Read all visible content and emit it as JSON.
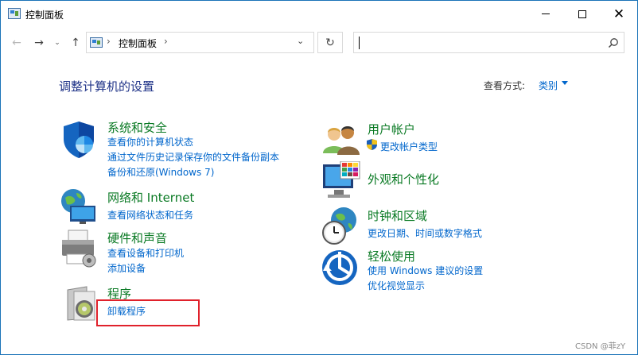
{
  "window": {
    "title": "控制面板",
    "controls": {
      "minimize": "—",
      "maximize": "□",
      "close": "✕"
    }
  },
  "nav": {
    "back": "←",
    "forward": "→",
    "history": "⌄",
    "up": "↑",
    "breadcrumb_sep": "›",
    "breadcrumb": "控制面板",
    "address_dropdown": "⌄",
    "refresh": "↻",
    "search_value": ""
  },
  "content": {
    "heading": "调整计算机的设置",
    "view_by_label": "查看方式:",
    "view_by_value": "类别"
  },
  "categories": [
    {
      "icon": "shield-icon",
      "title": "系统和安全",
      "links": [
        "查看你的计算机状态",
        "通过文件历史记录保存你的文件备份副本",
        "备份和还原(Windows 7)"
      ]
    },
    {
      "icon": "network-icon",
      "title": "网络和 Internet",
      "links": [
        "查看网络状态和任务"
      ]
    },
    {
      "icon": "printer-icon",
      "title": "硬件和声音",
      "links": [
        "查看设备和打印机",
        "添加设备"
      ]
    },
    {
      "icon": "programs-icon",
      "title": "程序",
      "links": [
        "卸载程序"
      ]
    },
    {
      "icon": "users-icon",
      "title": "用户帐户",
      "links": [
        "更改帐户类型"
      ]
    },
    {
      "icon": "monitor-icon",
      "title": "外观和个性化",
      "links": []
    },
    {
      "icon": "clock-globe-icon",
      "title": "时钟和区域",
      "links": [
        "更改日期、时间或数字格式"
      ]
    },
    {
      "icon": "ease-of-access-icon",
      "title": "轻松使用",
      "links": [
        "使用 Windows 建议的设置",
        "优化视觉显示"
      ]
    }
  ],
  "watermark": "CSDN @菲zY"
}
